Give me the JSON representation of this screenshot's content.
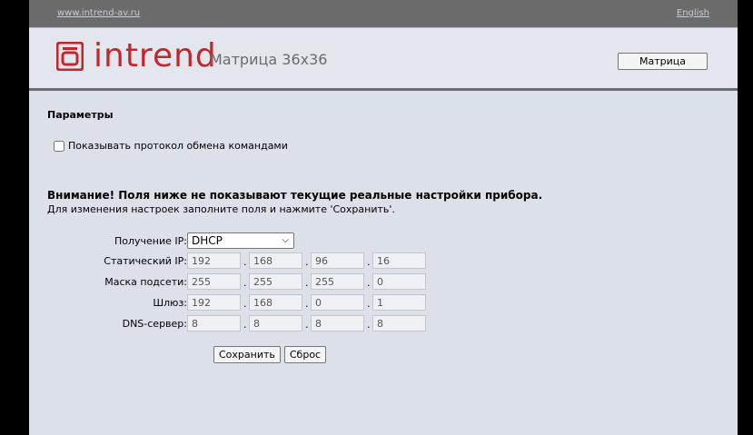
{
  "topbar": {
    "site_link": "www.intrend-av.ru",
    "language_link": "English"
  },
  "header": {
    "brand": "intrend",
    "device_title": "Матрица 36x36",
    "matrix_button": "Матрица"
  },
  "params": {
    "title": "Параметры",
    "show_log_label": "Показывать протокол обмена командами",
    "show_log_checked": false
  },
  "warning": {
    "title": "Внимание! Поля ниже не показывают текущие реальные настройки прибора.",
    "hint": "Для изменения настроек заполните поля и нажмите 'Сохранить'."
  },
  "network": {
    "ip_mode_label": "Получение IP:",
    "ip_mode_value": "DHCP",
    "static_ip_label": "Статический IP:",
    "static_ip": [
      "192",
      "168",
      "96",
      "16"
    ],
    "subnet_label": "Маска подсети:",
    "subnet": [
      "255",
      "255",
      "255",
      "0"
    ],
    "gateway_label": "Шлюз:",
    "gateway": [
      "192",
      "168",
      "0",
      "1"
    ],
    "dns_label": "DNS-сервер:",
    "dns": [
      "8",
      "8",
      "8",
      "8"
    ],
    "separator": "."
  },
  "actions": {
    "save": "Сохранить",
    "reset": "Сброс"
  },
  "colors": {
    "brand": "#c1272d",
    "page_bg": "#dce0e8",
    "topbar_bg": "#6b6b6b"
  }
}
